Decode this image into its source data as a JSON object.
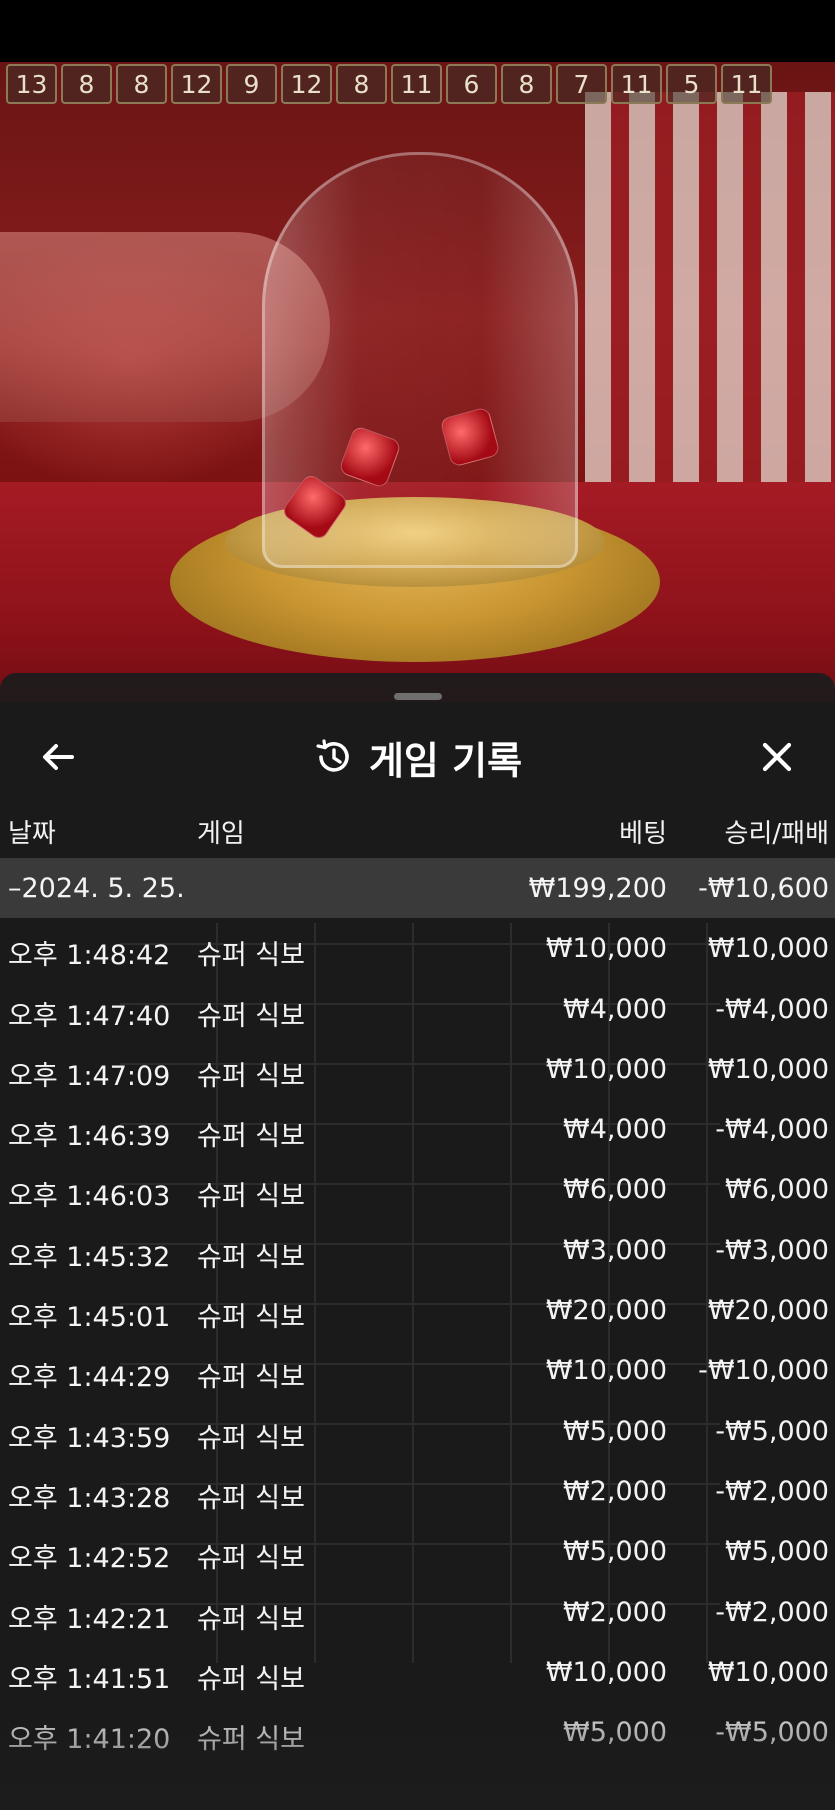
{
  "recent_results": [
    "13",
    "8",
    "8",
    "12",
    "9",
    "12",
    "8",
    "11",
    "6",
    "8",
    "7",
    "11",
    "5",
    "11"
  ],
  "header": {
    "title": "게임 기록",
    "icons": {
      "back": "arrow-left-icon",
      "history": "history-clock-icon",
      "close": "close-icon"
    }
  },
  "columns": {
    "date": "날짜",
    "game": "게임",
    "bet": "베팅",
    "result": "승리/패배"
  },
  "group": {
    "date": "–2024. 5. 25.",
    "bet": "₩199,200",
    "result": "-₩10,600"
  },
  "rows": [
    {
      "time": "오후 1:48:42",
      "game": "슈퍼 식보",
      "bet": "₩10,000",
      "result": "₩10,000"
    },
    {
      "time": "오후 1:47:40",
      "game": "슈퍼 식보",
      "bet": "₩4,000",
      "result": "-₩4,000"
    },
    {
      "time": "오후 1:47:09",
      "game": "슈퍼 식보",
      "bet": "₩10,000",
      "result": "₩10,000"
    },
    {
      "time": "오후 1:46:39",
      "game": "슈퍼 식보",
      "bet": "₩4,000",
      "result": "-₩4,000"
    },
    {
      "time": "오후 1:46:03",
      "game": "슈퍼 식보",
      "bet": "₩6,000",
      "result": "₩6,000"
    },
    {
      "time": "오후 1:45:32",
      "game": "슈퍼 식보",
      "bet": "₩3,000",
      "result": "-₩3,000"
    },
    {
      "time": "오후 1:45:01",
      "game": "슈퍼 식보",
      "bet": "₩20,000",
      "result": "₩20,000"
    },
    {
      "time": "오후 1:44:29",
      "game": "슈퍼 식보",
      "bet": "₩10,000",
      "result": "-₩10,000"
    },
    {
      "time": "오후 1:43:59",
      "game": "슈퍼 식보",
      "bet": "₩5,000",
      "result": "-₩5,000"
    },
    {
      "time": "오후 1:43:28",
      "game": "슈퍼 식보",
      "bet": "₩2,000",
      "result": "-₩2,000"
    },
    {
      "time": "오후 1:42:52",
      "game": "슈퍼 식보",
      "bet": "₩5,000",
      "result": "₩5,000"
    },
    {
      "time": "오후 1:42:21",
      "game": "슈퍼 식보",
      "bet": "₩2,000",
      "result": "-₩2,000"
    },
    {
      "time": "오후 1:41:51",
      "game": "슈퍼 식보",
      "bet": "₩10,000",
      "result": "₩10,000"
    },
    {
      "time": "오후 1:41:20",
      "game": "슈퍼 식보",
      "bet": "₩5,000",
      "result": "-₩5,000"
    }
  ]
}
